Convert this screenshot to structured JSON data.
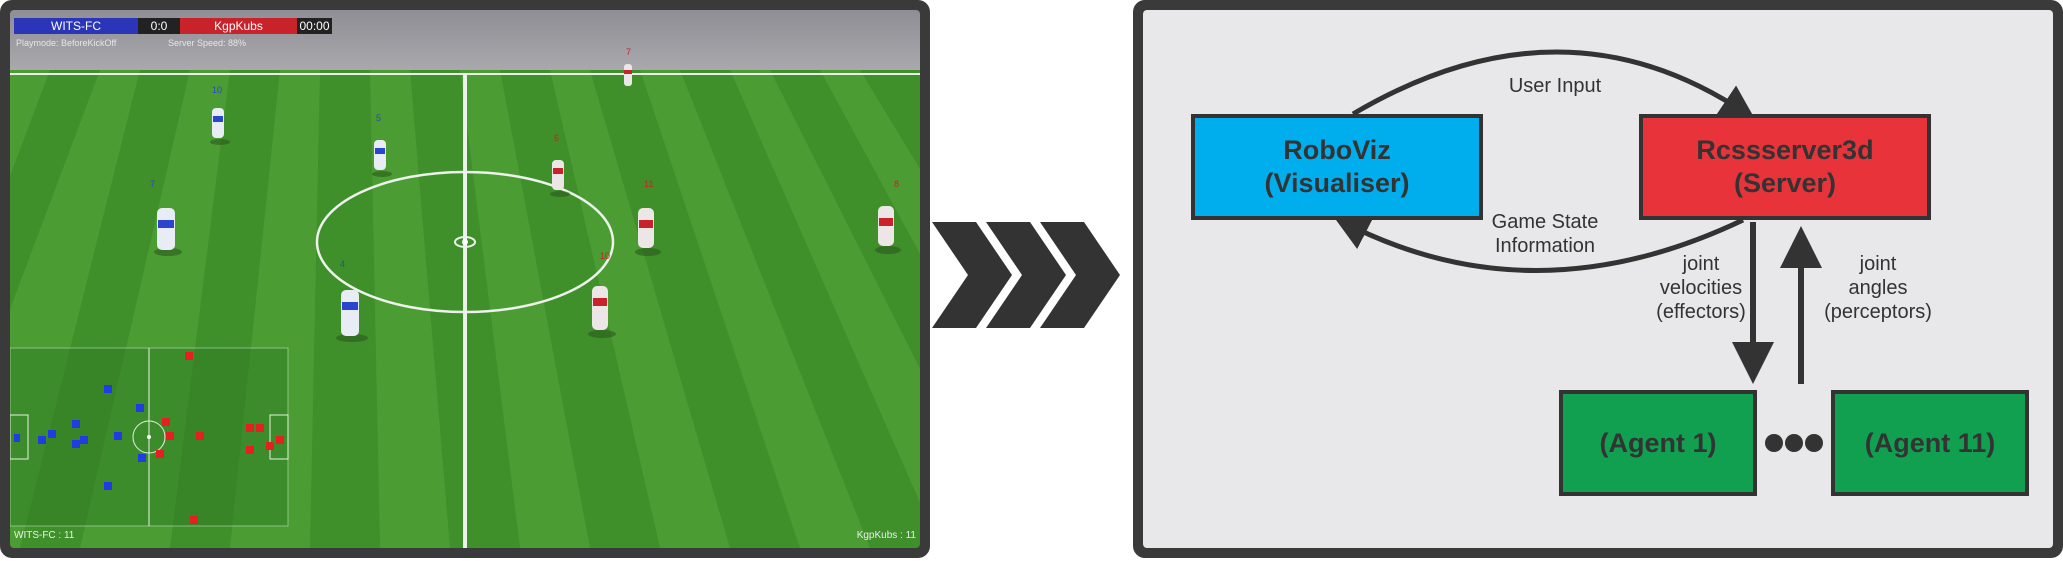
{
  "simulator": {
    "team_left": "WITS-FC",
    "score": "0:0",
    "team_right": "KgpKubs",
    "clock": "00:00",
    "playmode": "Playmode: BeforeKickOff",
    "server_speed": "Server Speed: 88%",
    "footer_left": "WITS-FC : 11",
    "footer_right": "KgpKubs : 11",
    "player_numbers_blue": [
      "10",
      "5",
      "7",
      "4"
    ],
    "player_numbers_red": [
      "7",
      "6",
      "11",
      "10",
      "8"
    ],
    "colors": {
      "blue_team": "#2a35b8",
      "red_team": "#c8232a",
      "pitch": "#3f8f2a"
    }
  },
  "diagram": {
    "roboviz": {
      "line1": "RoboViz",
      "line2": "(Visualiser)",
      "color": "#00aeee"
    },
    "server": {
      "line1": "Rcssserver3d",
      "line2": "(Server)",
      "color": "#e8333a"
    },
    "agent_first": "(Agent 1)",
    "agent_last": "(Agent 11)",
    "agent_color": "#10a050",
    "edge_user_input": "User Input",
    "edge_game_state": [
      "Game State",
      "Information"
    ],
    "edge_velocities": [
      "joint",
      "velocities",
      "(effectors)"
    ],
    "edge_angles": [
      "joint",
      "angles",
      "(perceptors)"
    ]
  }
}
